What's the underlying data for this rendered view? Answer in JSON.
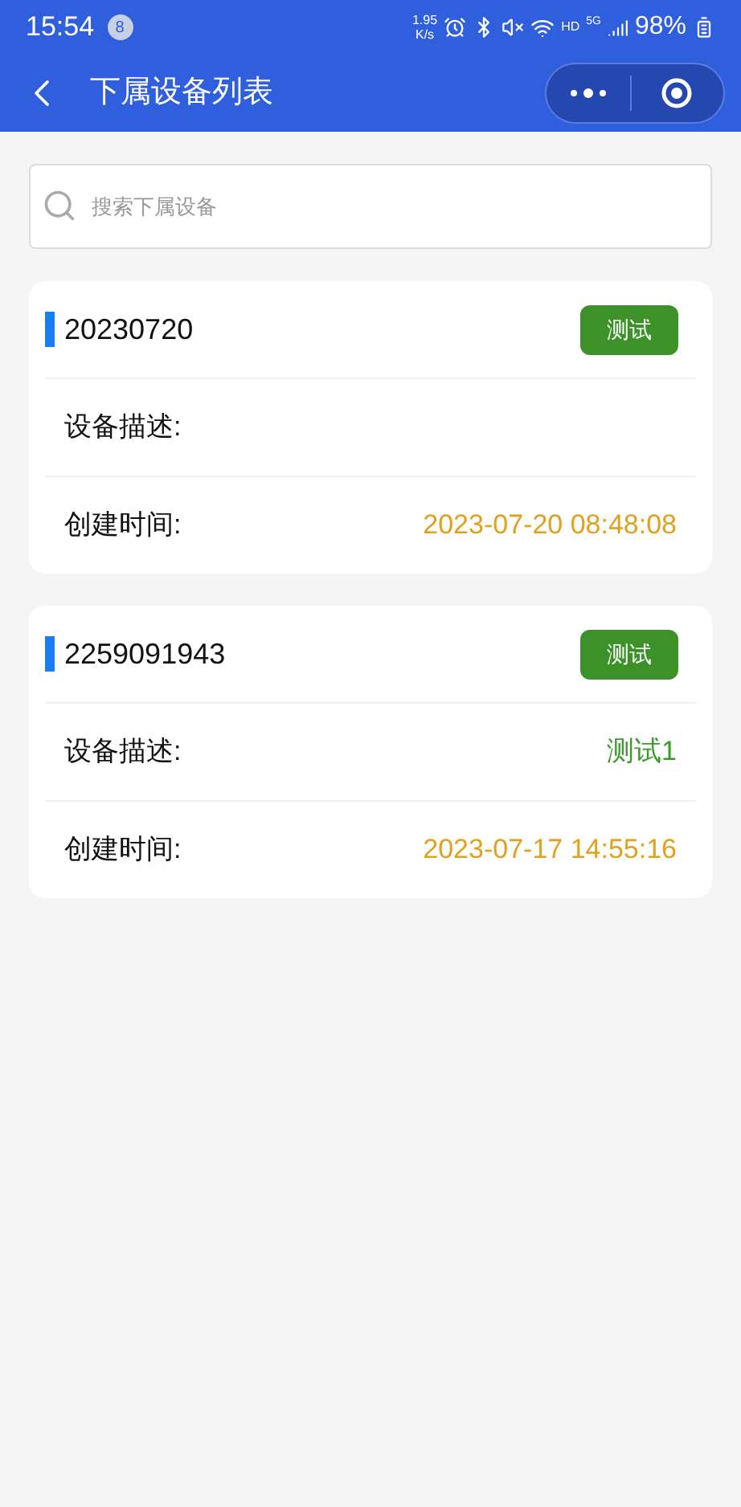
{
  "status_bar": {
    "time": "15:54",
    "notification_count": "8",
    "speed": "1.95",
    "speed_unit": "K/s",
    "hd": "HD",
    "network": "5G",
    "battery": "98%"
  },
  "nav": {
    "title": "下属设备列表"
  },
  "search": {
    "placeholder": "搜索下属设备"
  },
  "devices": [
    {
      "name": "20230720",
      "tag": "测试",
      "rows": [
        {
          "kind": "description",
          "label": "设备描述:"
        },
        {
          "kind": "created",
          "label": "创建时间:",
          "value": "2023-07-20 08:48:08"
        }
      ]
    },
    {
      "name": "2259091943",
      "tag": "测试",
      "rows": [
        {
          "kind": "description",
          "label": "设备描述:",
          "value": "测试1"
        },
        {
          "kind": "created",
          "label": "创建时间:",
          "value": "2023-07-17 14:55:16"
        }
      ]
    }
  ]
}
